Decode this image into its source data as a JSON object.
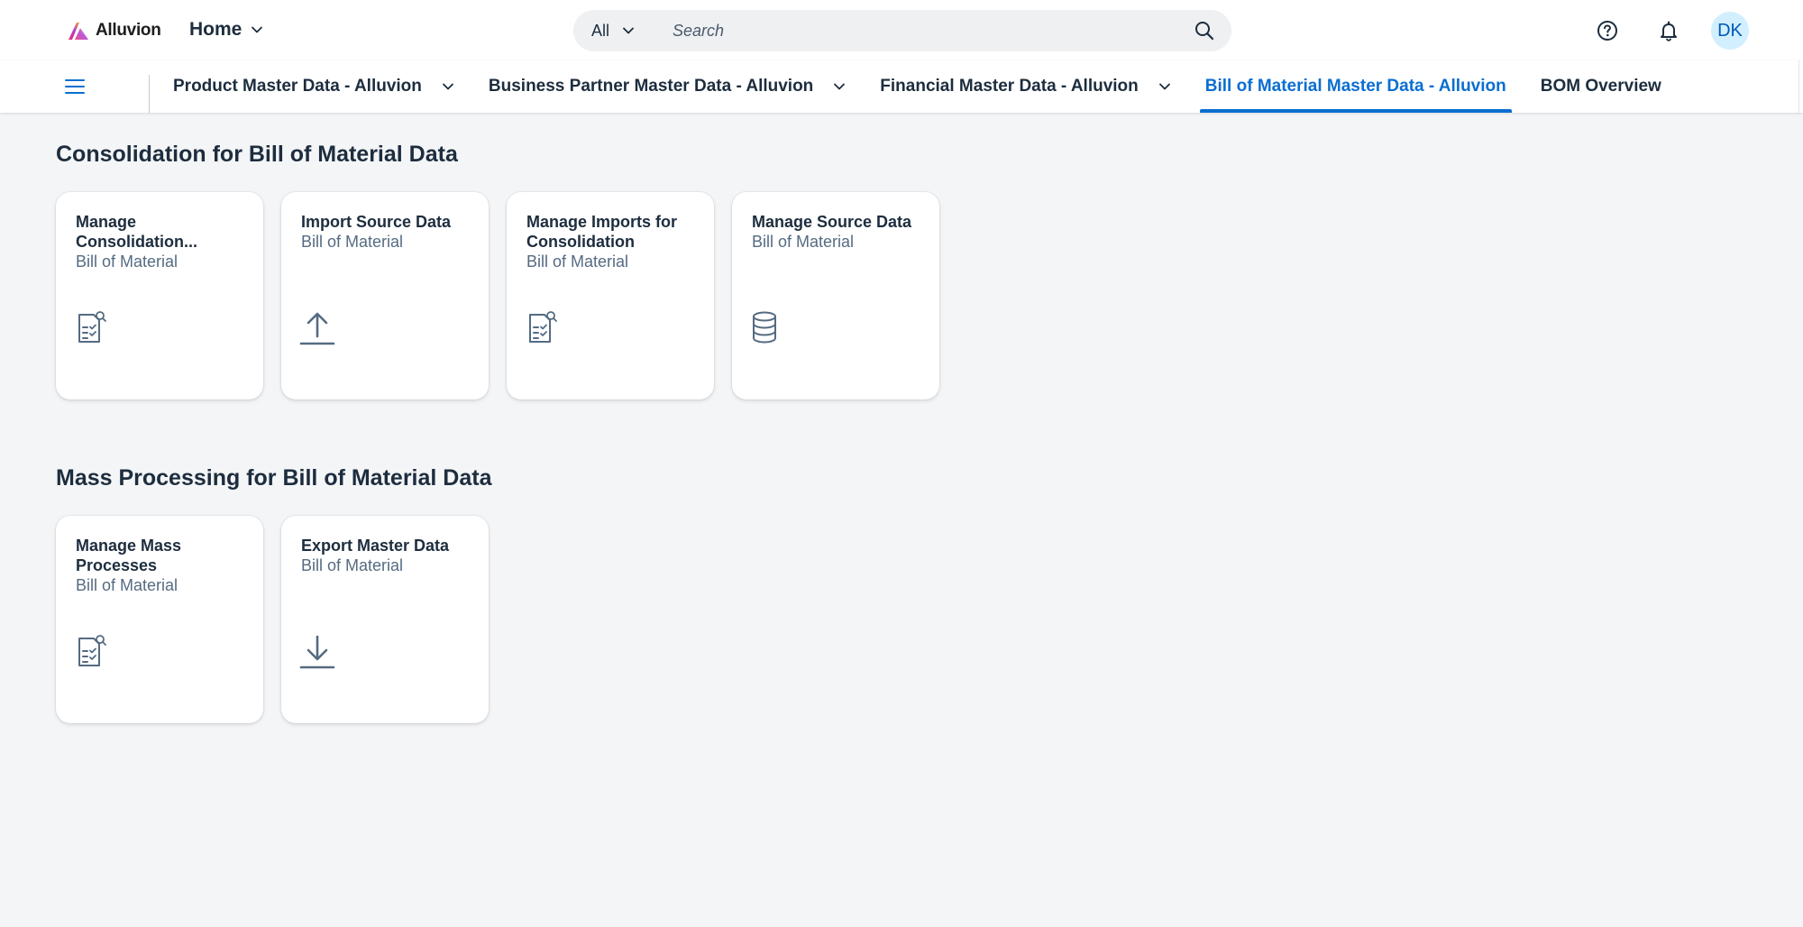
{
  "shell": {
    "brand": "Alluvion",
    "home_label": "Home",
    "search": {
      "scope": "All",
      "placeholder": "Search"
    },
    "avatar_initials": "DK"
  },
  "nav": {
    "tabs": [
      {
        "label": "Product Master Data - Alluvion",
        "has_menu": true
      },
      {
        "label": "Business Partner Master Data - Alluvion",
        "has_menu": true
      },
      {
        "label": "Financial Master Data - Alluvion",
        "has_menu": true
      },
      {
        "label": "Bill of Material Master Data - Alluvion",
        "has_menu": false,
        "active": true
      },
      {
        "label": "BOM Overview",
        "has_menu": false
      }
    ]
  },
  "sections": [
    {
      "title": "Consolidation for Bill of Material Data",
      "tiles": [
        {
          "title": "Manage Consolidation...",
          "subtitle": "Bill of Material",
          "icon": "document-inspect-icon"
        },
        {
          "title": "Import Source Data",
          "subtitle": "Bill of Material",
          "icon": "upload-icon"
        },
        {
          "title": "Manage Imports for Consolidation",
          "subtitle": "Bill of Material",
          "icon": "document-inspect-icon"
        },
        {
          "title": "Manage Source Data",
          "subtitle": "Bill of Material",
          "icon": "database-icon"
        }
      ]
    },
    {
      "title": "Mass Processing for Bill of Material Data",
      "tiles": [
        {
          "title": "Manage Mass Processes",
          "subtitle": "Bill of Material",
          "icon": "document-inspect-icon"
        },
        {
          "title": "Export Master Data",
          "subtitle": "Bill of Material",
          "icon": "download-icon"
        }
      ]
    }
  ],
  "colors": {
    "accent": "#0a6ed1",
    "text": "#1d2d3e",
    "subtext": "#556b82",
    "background": "#f4f5f7",
    "avatar_bg": "#d1efff"
  }
}
